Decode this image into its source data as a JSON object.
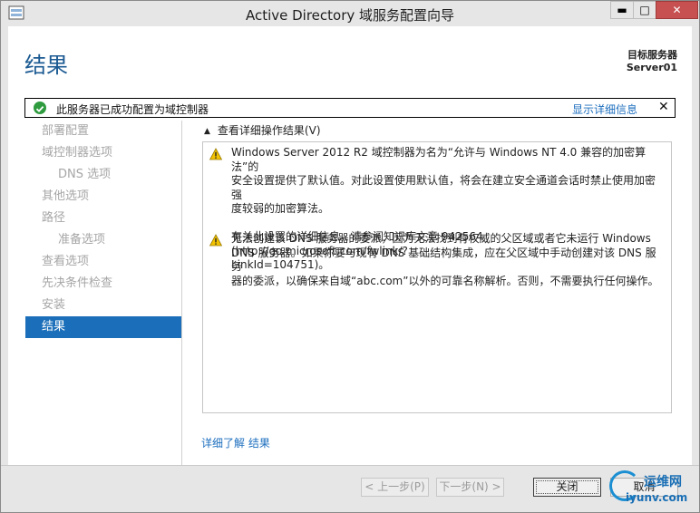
{
  "window": {
    "title": "Active Directory 域服务配置向导",
    "controls": {
      "minimize": "▬",
      "maximize": "□",
      "close": "✕"
    }
  },
  "header": {
    "page_title": "结果",
    "target_label": "目标服务器",
    "target_server": "Server01"
  },
  "notice": {
    "message": "此服务器已成功配置为域控制器",
    "link": "显示详细信息",
    "close": "✕",
    "icon": "success-check-icon"
  },
  "nav": {
    "items": [
      {
        "label": "部署配置"
      },
      {
        "label": "域控制器选项"
      },
      {
        "label": "DNS 选项"
      },
      {
        "label": "其他选项"
      },
      {
        "label": "路径"
      },
      {
        "label": "准备选项"
      },
      {
        "label": "查看选项"
      },
      {
        "label": "先决条件检查"
      },
      {
        "label": "安装"
      },
      {
        "label": "结果"
      }
    ],
    "active": "结果"
  },
  "details": {
    "heading": "查看详细操作结果(V)",
    "messages": [
      {
        "icon": "warning-icon",
        "lines": [
          "Windows Server 2012 R2 域控制器为名为“允许与 Windows NT 4.0 兼容的加密算法”的",
          "安全设置提供了默认值。对此设置使用默认值，将会在建立安全通道会话时禁止使用加密强",
          "度较弱的加密算法。",
          "",
          "有关此设置的详细信息，请参阅知识库文章 942564 (http://go.microsoft.com/fwlink/?",
          "LinkId=104751)。"
        ]
      },
      {
        "icon": "warning-icon",
        "lines": [
          "无法创建该 DNS 服务器的委派，因为无法找到有权威的父区域或者它未运行 Windows",
          "DNS 服务器。如果你要与现有 DNS 基础结构集成，应在父区域中手动创建对该 DNS 服务",
          "器的委派，以确保来自域“abc.com”以外的可靠名称解析。否则，不需要执行任何操作。"
        ]
      }
    ]
  },
  "learn_more": "详细了解 结果",
  "footer": {
    "prev": "< 上一步(P)",
    "next": "下一步(N) >",
    "close": "关闭",
    "cancel": "取消"
  },
  "watermark": {
    "line1": "运维网",
    "line2": "iyunv.com"
  },
  "colors": {
    "accent": "#1b6fba",
    "title": "#1b5a92",
    "link": "#1e6fbf",
    "success": "#2e9b3f",
    "warning": "#f2c200"
  }
}
